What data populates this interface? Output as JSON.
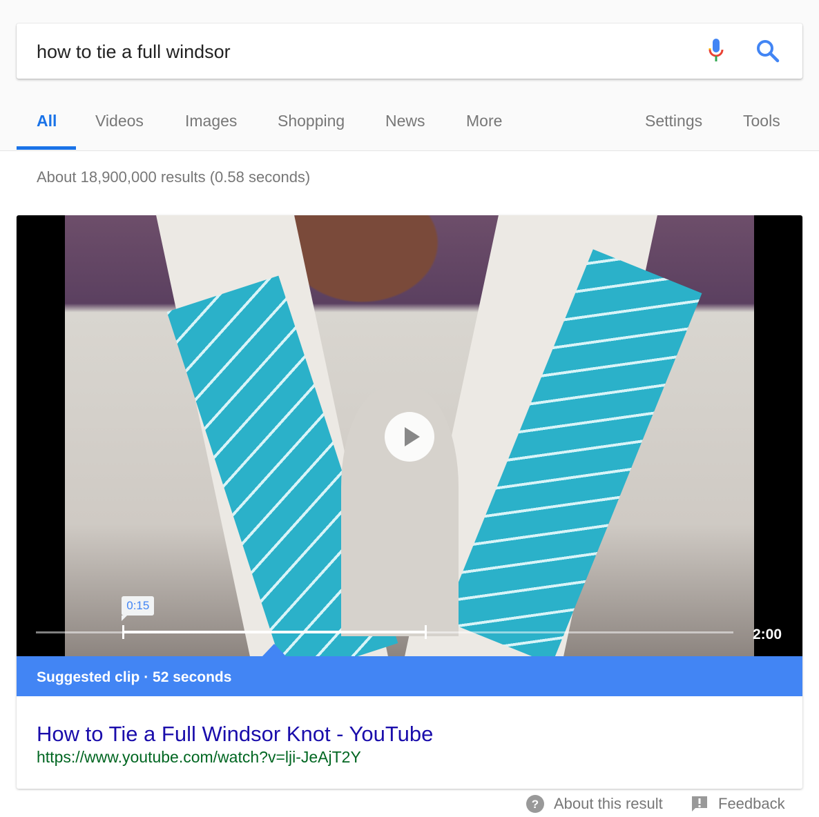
{
  "search": {
    "query": "how to tie a full windsor",
    "mic_icon": "microphone-icon",
    "search_icon": "search-icon"
  },
  "tabs": [
    {
      "label": "All",
      "active": true
    },
    {
      "label": "Videos"
    },
    {
      "label": "Images"
    },
    {
      "label": "Shopping"
    },
    {
      "label": "News"
    },
    {
      "label": "More"
    }
  ],
  "tools": [
    {
      "label": "Settings"
    },
    {
      "label": "Tools"
    }
  ],
  "result_stats": "About 18,900,000 results (0.58 seconds)",
  "video": {
    "clip_start_label": "0:15",
    "clip_start_seconds": 15,
    "clip_length_seconds": 52,
    "duration_seconds": 120,
    "duration_label": "2:00"
  },
  "suggested_clip": "Suggested clip · 52 seconds",
  "result": {
    "title": "How to Tie a Full Windsor Knot - YouTube",
    "url": "https://www.youtube.com/watch?v=lji-JeAjT2Y"
  },
  "footer": {
    "about": "About this result",
    "feedback": "Feedback"
  },
  "colors": {
    "accent": "#4285f4",
    "link": "#1a0dab",
    "url": "#006621"
  }
}
